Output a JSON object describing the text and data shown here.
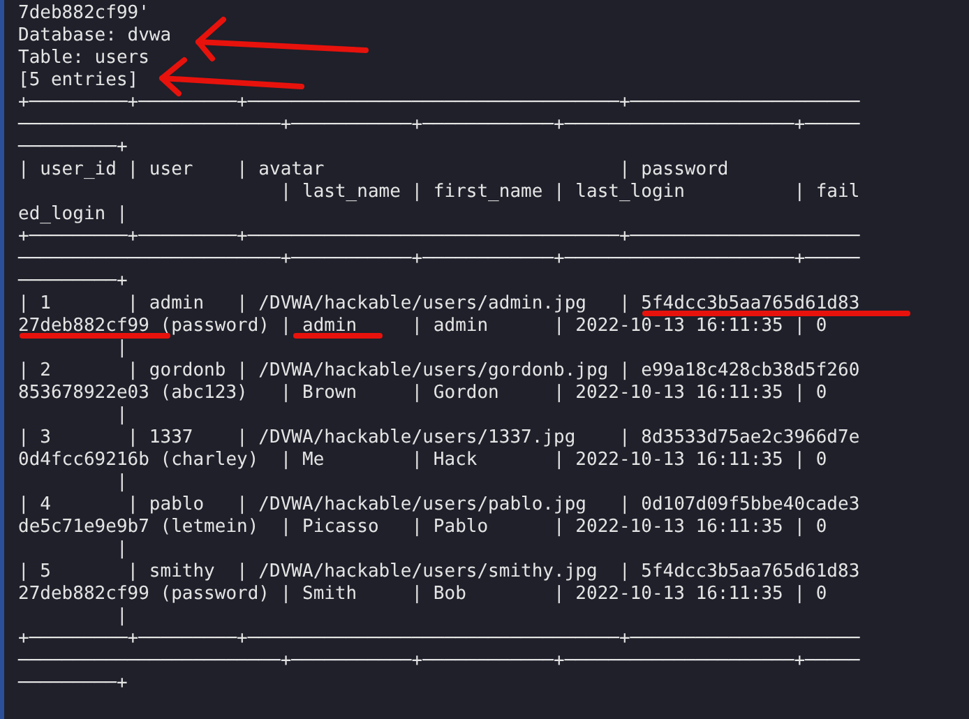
{
  "terminal": {
    "lines": [
      "7deb882cf99'",
      "Database: dvwa",
      "Table: users",
      "[5 entries]",
      "+─────────+─────────+──────────────────────────────────+─────────────────────",
      "────────────────────────+───────────+────────────+─────────────────────+─────",
      "─────────+",
      "| user_id | user    | avatar                           | password",
      "                        | last_name | first_name | last_login          | fail",
      "ed_login |",
      "+─────────+─────────+──────────────────────────────────+─────────────────────",
      "────────────────────────+───────────+────────────+─────────────────────+─────",
      "─────────+",
      "| 1       | admin   | /DVWA/hackable/users/admin.jpg   | 5f4dcc3b5aa765d61d83",
      "27deb882cf99 (password) | admin     | admin      | 2022-10-13 16:11:35 | 0",
      "         |",
      "| 2       | gordonb | /DVWA/hackable/users/gordonb.jpg | e99a18c428cb38d5f260",
      "853678922e03 (abc123)   | Brown     | Gordon     | 2022-10-13 16:11:35 | 0",
      "         |",
      "| 3       | 1337    | /DVWA/hackable/users/1337.jpg    | 8d3533d75ae2c3966d7e",
      "0d4fcc69216b (charley)  | Me        | Hack       | 2022-10-13 16:11:35 | 0",
      "         |",
      "| 4       | pablo   | /DVWA/hackable/users/pablo.jpg   | 0d107d09f5bbe40cade3",
      "de5c71e9e9b7 (letmein)  | Picasso   | Pablo      | 2022-10-13 16:11:35 | 0",
      "         |",
      "| 5       | smithy  | /DVWA/hackable/users/smithy.jpg  | 5f4dcc3b5aa765d61d83",
      "27deb882cf99 (password) | Smith     | Bob        | 2022-10-13 16:11:35 | 0",
      "         |",
      "+─────────+─────────+──────────────────────────────────+─────────────────────",
      "────────────────────────+───────────+────────────+─────────────────────+─────",
      "─────────+"
    ]
  }
}
